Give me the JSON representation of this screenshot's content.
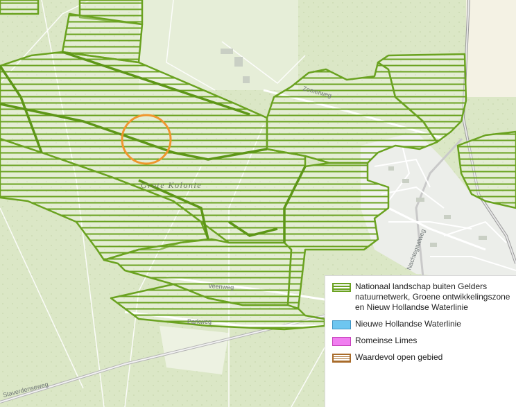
{
  "map": {
    "place_label": "Grote Kolonie",
    "roads": {
      "zomerweg": "Zomerweg",
      "veenweg": "Veenweg",
      "parkweg": "Parkweg",
      "staverdenseweg": "Staverdenseweg",
      "nachtegaalweg": "Nachtegaalweg"
    },
    "marker_color": "#f0962d",
    "hatch_color": "#6aa220"
  },
  "legend": {
    "items": [
      {
        "label": "Nationaal landschap buiten Gelders natuurnetwerk, Groene ontwikkelingszone en Nieuw Hollandse Waterlinie",
        "color": "#6aa220",
        "swatch": "hatched"
      },
      {
        "label": "Nieuwe Hollandse Waterlinie",
        "color": "#6ec6f0",
        "swatch": "solid"
      },
      {
        "label": "Romeinse Limes",
        "color": "#f07ef0",
        "swatch": "solid"
      },
      {
        "label": "Waardevol open gebied",
        "color": "#a86b2a",
        "swatch": "hatched"
      }
    ]
  }
}
